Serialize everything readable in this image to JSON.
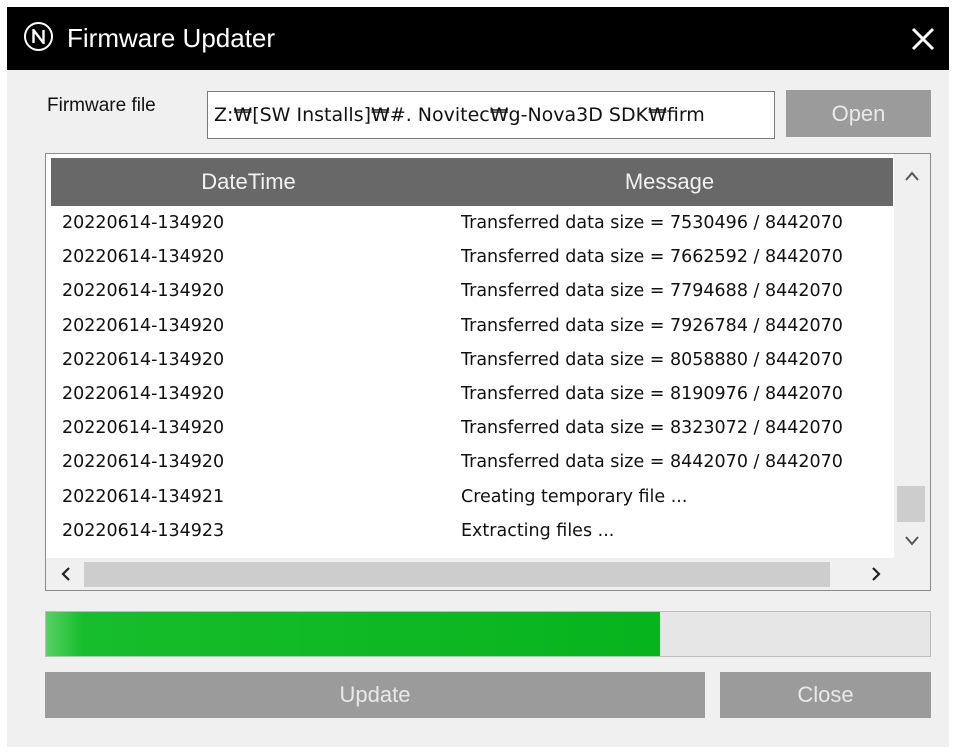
{
  "window": {
    "title": "Firmware Updater",
    "logo_letter": "N"
  },
  "file": {
    "label": "Firmware file",
    "value": "Z:₩[SW Installs]₩#. Novitec₩g-Nova3D SDK₩firm",
    "open_label": "Open"
  },
  "log": {
    "columns": [
      "DateTime",
      "Message"
    ],
    "rows": [
      {
        "datetime": "20220614-134920",
        "message": "Transferred data size = 7530496 / 8442070"
      },
      {
        "datetime": "20220614-134920",
        "message": "Transferred data size = 7662592 / 8442070"
      },
      {
        "datetime": "20220614-134920",
        "message": "Transferred data size = 7794688 / 8442070"
      },
      {
        "datetime": "20220614-134920",
        "message": "Transferred data size = 7926784 / 8442070"
      },
      {
        "datetime": "20220614-134920",
        "message": "Transferred data size = 8058880 / 8442070"
      },
      {
        "datetime": "20220614-134920",
        "message": "Transferred data size = 8190976 / 8442070"
      },
      {
        "datetime": "20220614-134920",
        "message": "Transferred data size = 8323072 / 8442070"
      },
      {
        "datetime": "20220614-134920",
        "message": "Transferred data size = 8442070 / 8442070"
      },
      {
        "datetime": "20220614-134921",
        "message": "Creating temporary file ..."
      },
      {
        "datetime": "20220614-134923",
        "message": "Extracting files ..."
      }
    ]
  },
  "progress": {
    "fraction": 0.695,
    "color": "#06b41e"
  },
  "buttons": {
    "update_label": "Update",
    "close_label": "Close"
  },
  "icons": {
    "logo": "n-circle-logo",
    "close": "close-icon",
    "scroll_up": "chevron-up-icon",
    "scroll_down": "chevron-down-icon",
    "scroll_left": "chevron-left-icon",
    "scroll_right": "chevron-right-icon"
  },
  "colors": {
    "titlebar": "#000000",
    "header": "#686868",
    "button": "#9b9b9b",
    "progress": "#06b41e"
  }
}
